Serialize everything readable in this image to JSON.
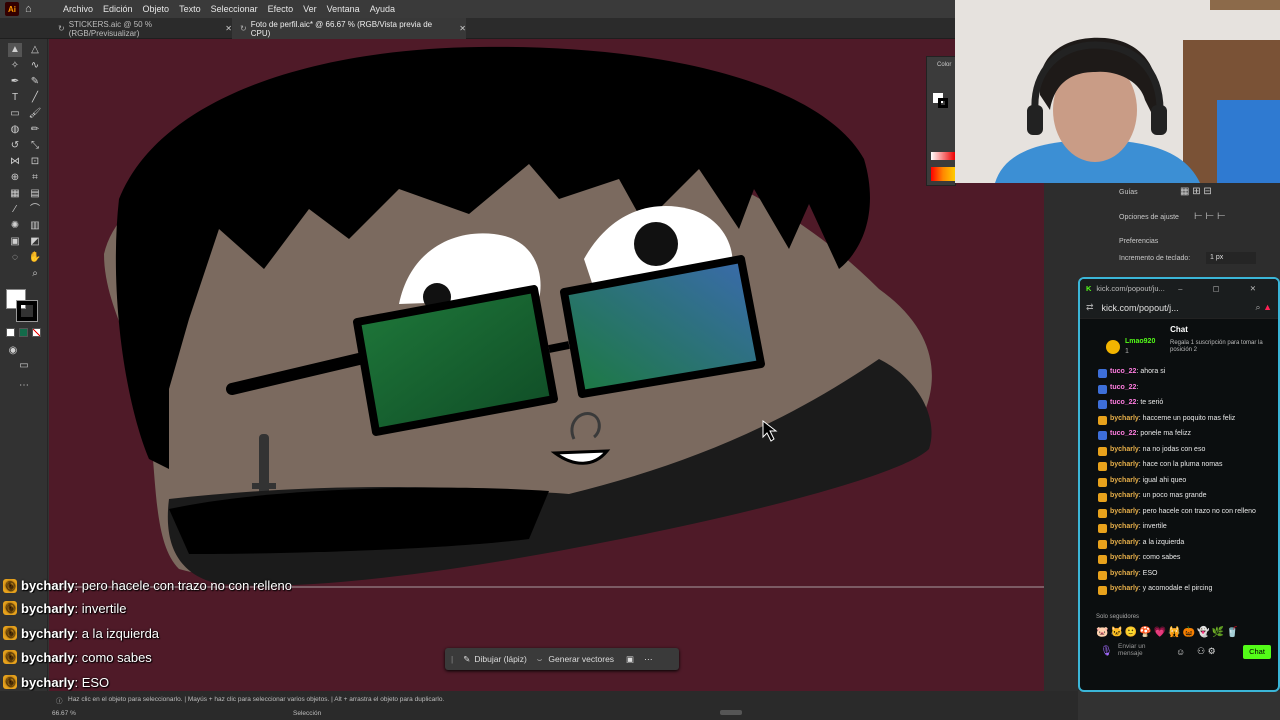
{
  "app": {
    "logo": "Ai",
    "menu": [
      "Archivo",
      "Edición",
      "Objeto",
      "Texto",
      "Seleccionar",
      "Efecto",
      "Ver",
      "Ventana",
      "Ayuda"
    ]
  },
  "tabs": [
    {
      "label": "STICKERS.aic @ 50 % (RGB/Previsualizar)",
      "active": false
    },
    {
      "label": "Foto de perfil.aic* @ 66.67 % (RGB/Vista previa de CPU)",
      "active": true
    }
  ],
  "right_panel": {
    "color_label": "Color",
    "guias": "Guías",
    "opciones_ajuste": "Opciones de ajuste",
    "preferencias": "Preferencias",
    "incremento_label": "Incremento de teclado:",
    "incremento_value": "1 px"
  },
  "context_bar": {
    "draw_label": "Dibujar (lápiz)",
    "vectors_label": "Generar vectores"
  },
  "status": {
    "hint": "Haz clic en el objeto para seleccionarlo.  |  Mayús + haz clic para seleccionar varios objetos.  |  Alt + arrastra el objeto para duplicarlo.",
    "zoom": "66.67 %",
    "mode": "Selección"
  },
  "kick": {
    "window_title": "kick.com/popout/ju...",
    "url": "kick.com/popout/j...",
    "chat_title": "Chat",
    "pinned_user": "Lmao920",
    "pinned_count": "1",
    "pinned_text": "Regala 1 suscripción para tomar la posición 2",
    "messages": [
      {
        "user": "tuco_22",
        "text": ": ahora si",
        "color": "#ff7de0"
      },
      {
        "user": "tuco_22",
        "text": ":",
        "color": "#ff7de0"
      },
      {
        "user": "tuco_22",
        "text": ": te serió",
        "color": "#ff7de0"
      },
      {
        "user": "bycharly",
        "text": ": hacceme un poquito mas feliz",
        "color": "#e8b04a"
      },
      {
        "user": "tuco_22",
        "text": ": ponele ma felizz",
        "color": "#ff7de0"
      },
      {
        "user": "bycharly",
        "text": ": na no jodas con eso",
        "color": "#e8b04a"
      },
      {
        "user": "bycharly",
        "text": ": hace con la pluma nomas",
        "color": "#e8b04a"
      },
      {
        "user": "bycharly",
        "text": ": igual ahi queo",
        "color": "#e8b04a"
      },
      {
        "user": "bycharly",
        "text": ": un poco mas grande",
        "color": "#e8b04a"
      },
      {
        "user": "bycharly",
        "text": ": pero hacele con trazo no con relleno",
        "color": "#e8b04a"
      },
      {
        "user": "bycharly",
        "text": ": invertile",
        "color": "#e8b04a"
      },
      {
        "user": "bycharly",
        "text": ": a la izquierda",
        "color": "#e8b04a"
      },
      {
        "user": "bycharly",
        "text": ": como sabes",
        "color": "#e8b04a"
      },
      {
        "user": "bycharly",
        "text": ": ESO",
        "color": "#e8b04a"
      },
      {
        "user": "bycharly",
        "text": ": y acomodale el pircing",
        "color": "#e8b04a"
      }
    ],
    "followers_only": "Solo seguidores",
    "send_placeholder": "Enviar un mensaje",
    "chat_button": "Chat"
  },
  "overlay_chat": [
    {
      "user": "bycharly",
      "text": ": pero hacele con trazo no con relleno"
    },
    {
      "user": "bycharly",
      "text": ": invertile"
    },
    {
      "user": "bycharly",
      "text": ": a la izquierda"
    },
    {
      "user": "bycharly",
      "text": ": como sabes"
    },
    {
      "user": "bycharly",
      "text": ": ESO"
    },
    {
      "user": "bycharly",
      "text": ": y acomodale el pircing"
    }
  ],
  "colors": {
    "canvas_bg": "#4f1a28",
    "skin": "#7b6a5f",
    "hair": "#000000",
    "kick_green": "#53fc18",
    "kick_border": "#3bb6d8"
  }
}
